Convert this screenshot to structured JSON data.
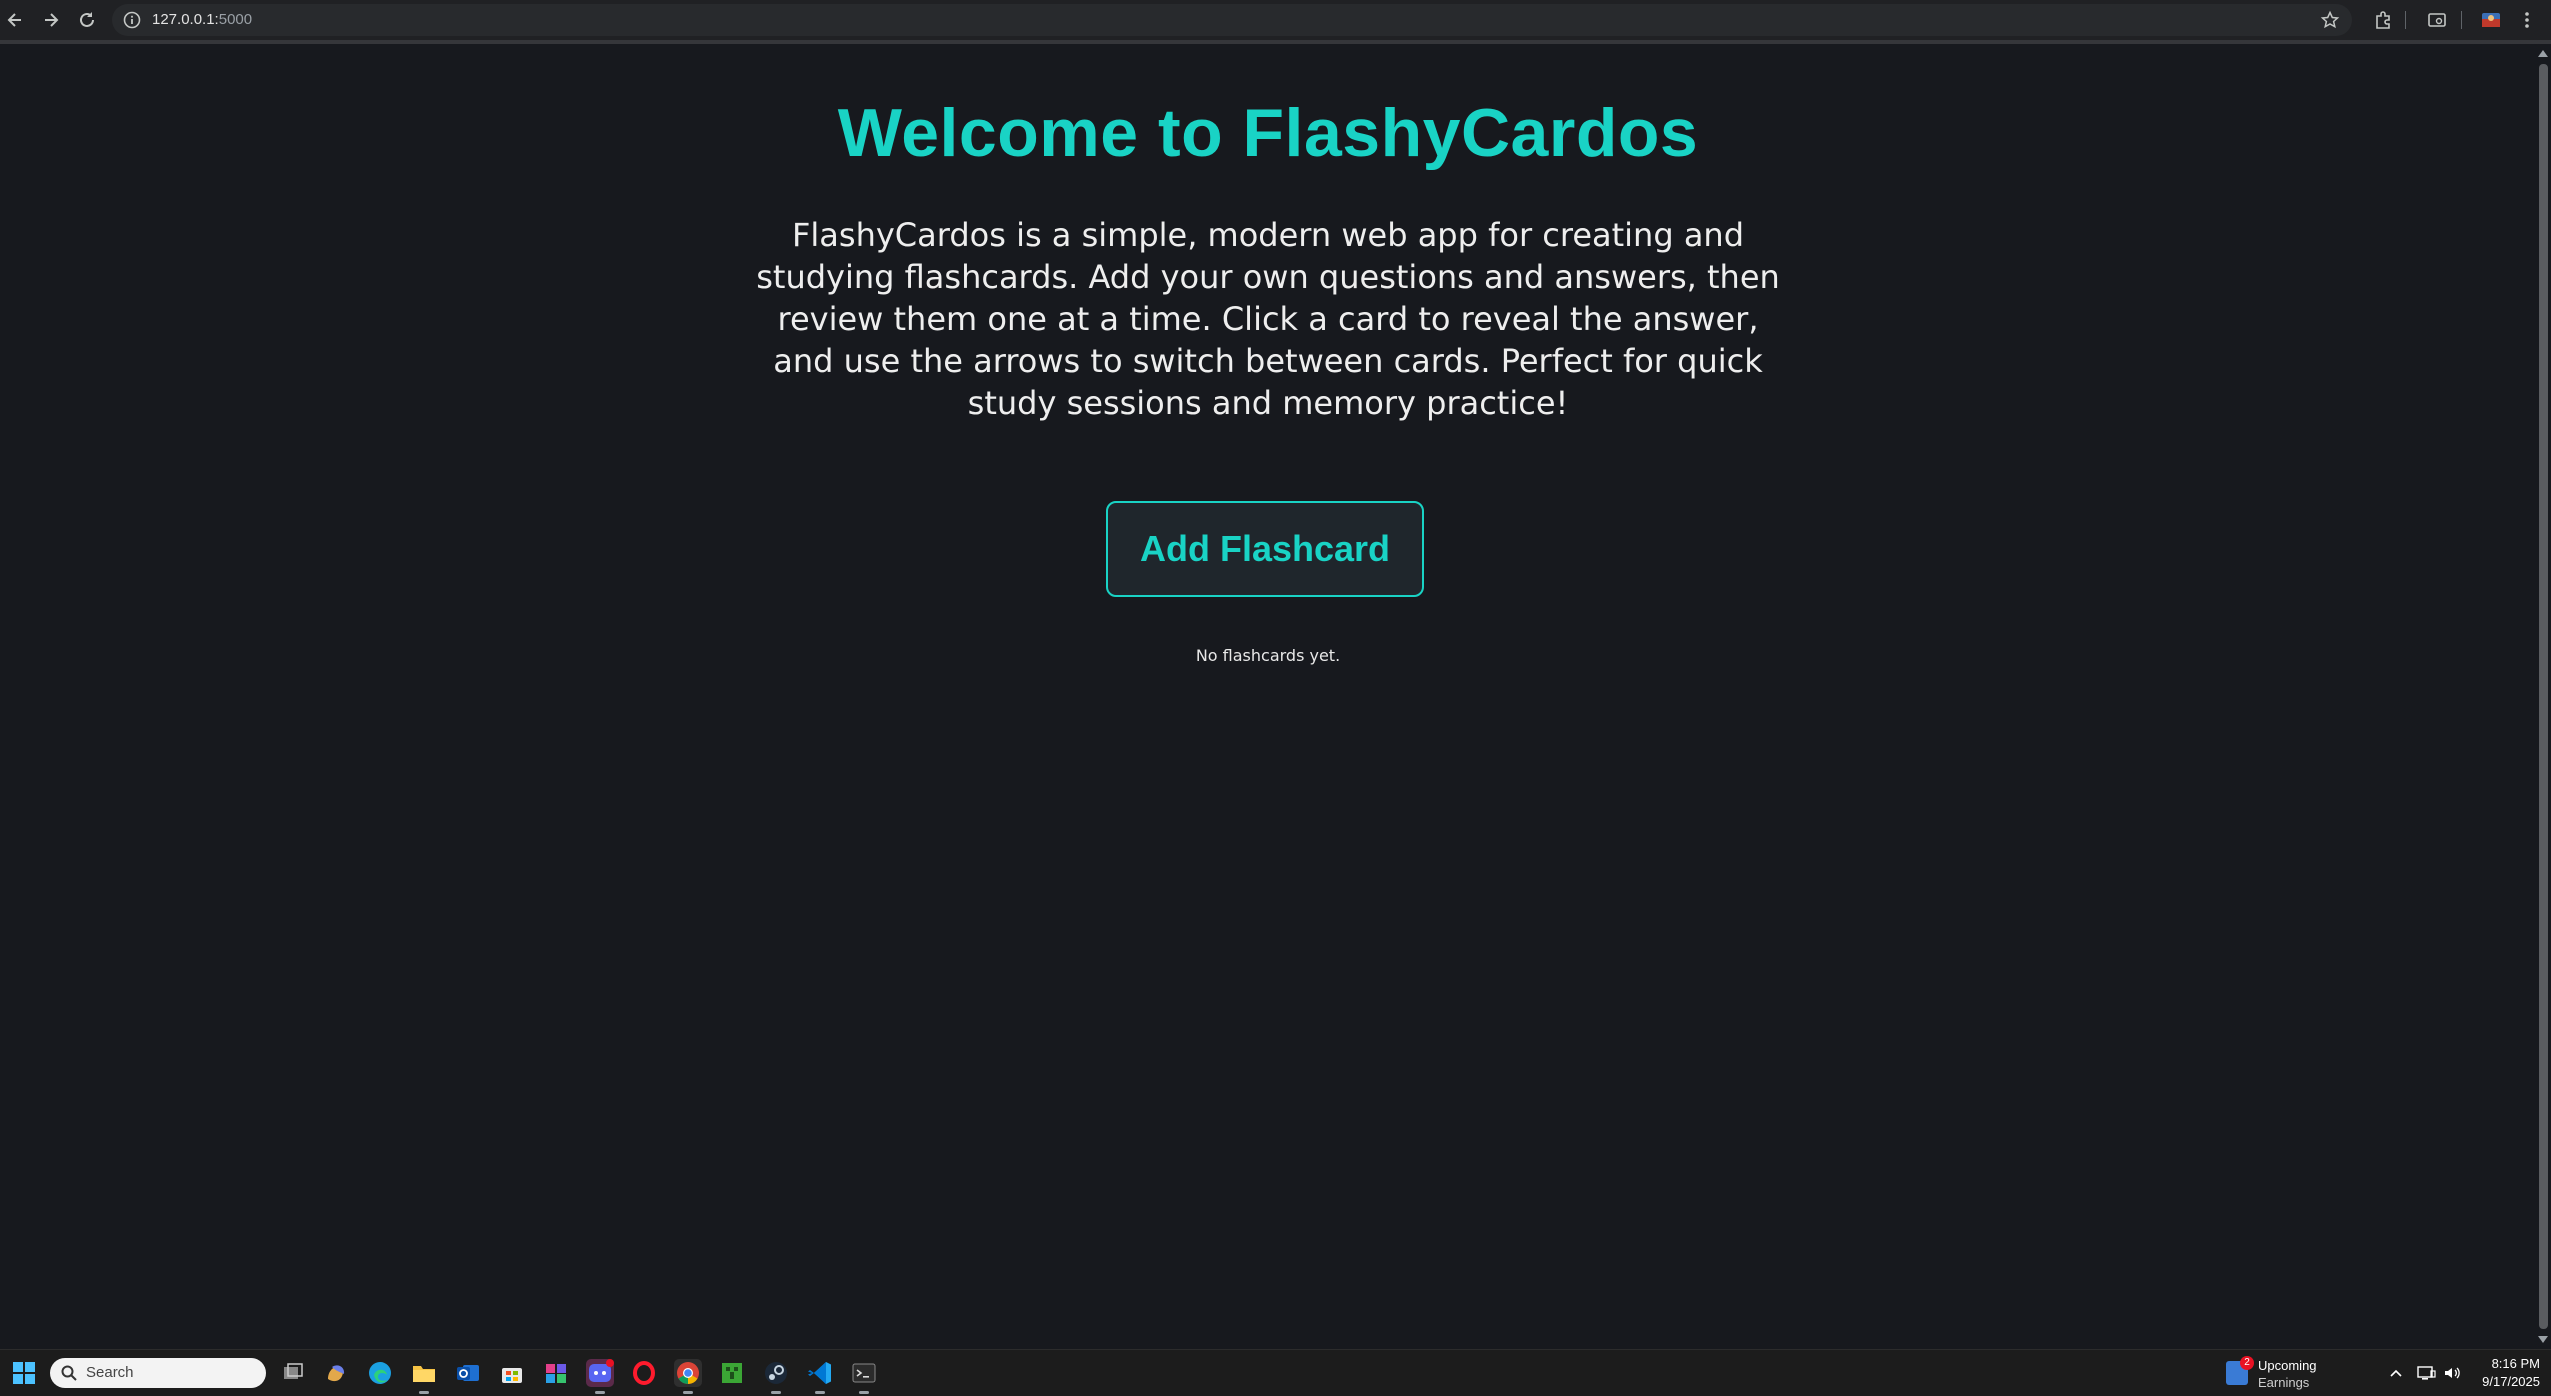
{
  "browser": {
    "url_host": "127.0.0.1:",
    "url_port": "5000"
  },
  "page": {
    "title": "Welcome to FlashyCardos",
    "description": "FlashyCardos is a simple, modern web app for creating and studying flashcards. Add your own questions and answers, then review them one at a time. Click a card to reveal the answer, and use the arrows to switch between cards. Perfect for quick study sessions and memory practice!",
    "add_button_label": "Add Flashcard",
    "empty_message": "No flashcards yet.",
    "accent_color": "#19d3c5",
    "background_color": "#17191e"
  },
  "taskbar": {
    "search_placeholder": "Search",
    "widget_badge": "2",
    "widget_line1": "Upcoming",
    "widget_line2": "Earnings",
    "time": "8:16 PM",
    "date": "9/17/2025",
    "apps": [
      "start-icon",
      "task-view-icon",
      "copilot-icon",
      "edge-icon",
      "file-explorer-icon",
      "outlook-icon",
      "store-icon",
      "m365-icon",
      "discord-icon",
      "opera-icon",
      "chrome-icon",
      "minecraft-icon",
      "steam-icon",
      "vscode-icon",
      "terminal-icon"
    ]
  }
}
